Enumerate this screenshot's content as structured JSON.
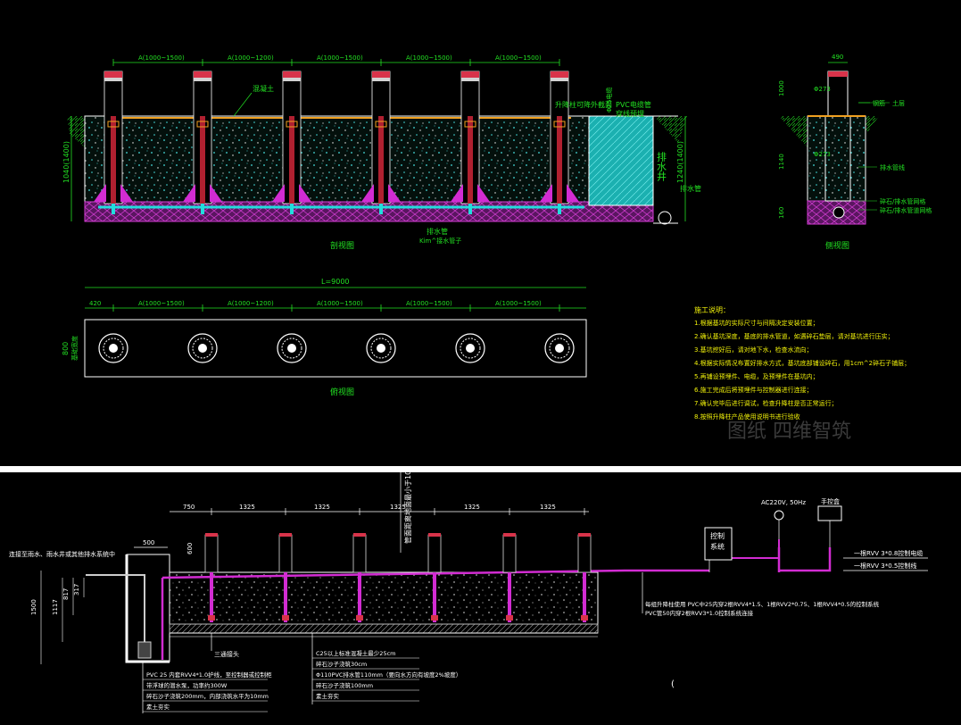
{
  "top": {
    "front_view": {
      "dims": [
        "A(1000~1500)",
        "A(1000~1200)",
        "A(1000~1500)",
        "A(1000~1500)",
        "A(1000~1500)"
      ],
      "left_height": "1040(1400)",
      "right_height": "1240(1400)",
      "labels": {
        "top_cap": "混凝土",
        "drain_pipe_note": "升降柱可降外截面",
        "pvc_top": "PVC电缆管",
        "pvc_bottom": "穿线预埋",
        "pvc_size": "Φ25电缆",
        "well_v": "排水井",
        "well_side": "排水管",
        "drain": "排水管",
        "drain_sub": "Kim^接水管子"
      },
      "title": "剖视图"
    },
    "side_view": {
      "top_dim": "490",
      "dims": [
        "1000",
        "Φ273",
        "Φ273",
        "1140",
        "160"
      ],
      "labels": [
        "钢筋",
        "土层",
        "排水管线",
        "碎石/排水管网格",
        "碎石/排水管道网格"
      ],
      "title": "侧视图"
    },
    "plan_view": {
      "total": "L=9000",
      "dims": [
        "420",
        "A(1000~1500)",
        "A(1000~1200)",
        "A(1000~1500)",
        "A(1000~1500)",
        "A(1000~1500)"
      ],
      "left_dim": "800",
      "left_dim2": "基础宽度",
      "title": "俯视图"
    },
    "notes": {
      "title": "施工说明：",
      "items": [
        "1.根据基坑的实际尺寸与间隔决定安装位置；",
        "2.确认基坑深度，基底的排水管道，如遇碎石垫层，请对基坑进行压实；",
        "3.基坑挖好后，请对地下水，检查水流向；",
        "4.根据实际情况布置好排水方式，基坑底部铺设碎石，用1cm^2碎石子铺层；",
        "5.再铺设预埋件、电缆，及预埋件在基坑内；",
        "6.施工完成后将预埋件与控制器进行连接；",
        "7.确认完毕后进行调试，检查升降柱是否正常运行；",
        "8.按照升降柱产品使用说明书进行验收"
      ],
      "watermark": "图纸 四维智筑"
    }
  },
  "bottom": {
    "dims": [
      "750",
      "1325",
      "1325",
      "1325",
      "1325",
      "1325"
    ],
    "vertical_note": "管面距离地面最小于100",
    "left_dims": [
      "500",
      "600",
      "1500",
      "1117",
      "817",
      "317"
    ],
    "left_top_note": "连接至雨水、雨水井或其他排水系统中",
    "control_box": [
      "控制",
      "系统"
    ],
    "power": "AC220V, 50Hz",
    "hand_box": "手控盒",
    "cable1": "一根RVV 3*0.8控制电缆",
    "cable2": "一根RVV 3*0.5控制线",
    "cable_note1": "每组升降柱使用 PVC中25内穿2根RVV4*1.5、1根RVV2*0.75、1根RVV4*0.5的控制系统",
    "cable_note2": "PVC管50内穿2根RVV3*1.0控制系统连接",
    "callouts": [
      "C25以上标准混凝土最少25cm",
      "碎石沙子浇筑30cm",
      "Φ110PVC排水管110mm（要向水方向有坡度2%坡度）",
      "碎石沙子浇筑100mm",
      "素土夯实"
    ],
    "left_callouts": [
      "PVC 25 内套RVV4*1.0护线，至控制器或控制柜",
      "带浮球的潜水泵，功率约300W",
      "碎石沙子浇筑200mm，内部浇筑水平为10mm",
      "素土夯实"
    ],
    "three_way": "三通接头",
    "cursor": "("
  }
}
